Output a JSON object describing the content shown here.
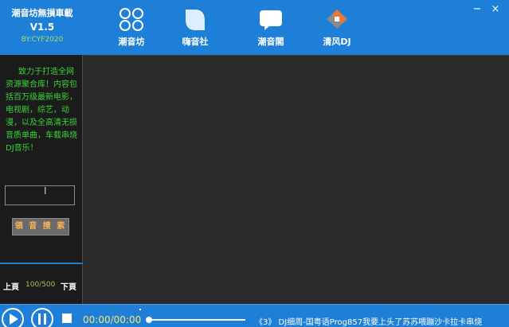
{
  "app": {
    "title": "潮音坊無損車載",
    "version": "V1.5",
    "author": "BY:CYF2020"
  },
  "nav": {
    "tabs": [
      {
        "label": "潮音坊",
        "icon": "clover-icon"
      },
      {
        "label": "嗨音社",
        "icon": "leaf-icon"
      },
      {
        "label": "潮音閣",
        "icon": "chat-bubble-icon"
      },
      {
        "label": "清风DJ",
        "icon": "dj-icon"
      }
    ]
  },
  "window": {
    "minimize": "−",
    "close": "×"
  },
  "sidebar": {
    "intro": "致力于打造全网资源聚合库！内容包括百万级最新电影，电视剧，综艺，动漫，以及全高清无损音质单曲，车载串烧DJ音乐！",
    "search_value": "",
    "search_button": "領 音 搜 索",
    "prev_page": "上頁",
    "page_count": "100/500",
    "next_page": "下頁"
  },
  "player": {
    "time": "00:00/00:00",
    "progress": 0,
    "now_playing": "《3》 DJ细周-国粤语Prog857我要上头了苏苏喂蹦沙卡拉卡串烧"
  },
  "colors": {
    "accent": "#1e7fd8",
    "intro_text": "#3ad43a",
    "time_text": "#ffe46b",
    "button_text": "#ffb357"
  }
}
